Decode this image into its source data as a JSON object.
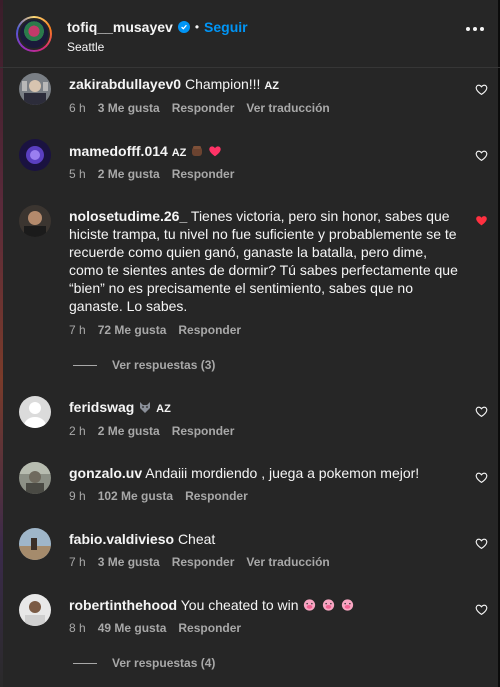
{
  "header": {
    "username": "tofiq__musayev",
    "separator": "•",
    "follow_label": "Seguir",
    "location": "Seattle"
  },
  "comments": [
    {
      "username": "zakirabdullayev0",
      "text": "Champion!!! ",
      "suffix": "AZ",
      "time": "6 h",
      "likes": "3 Me gusta",
      "reply": "Responder",
      "translate": "Ver traducción",
      "liked": false
    },
    {
      "username": "mamedofff.014",
      "text": "",
      "suffix": "AZ",
      "time": "5 h",
      "likes": "2 Me gusta",
      "reply": "Responder",
      "liked": false
    },
    {
      "username": "nolosetudime.26_",
      "text": "Tienes victoria, pero sin honor, sabes que hiciste trampa, tu nivel no fue suficiente y probablemente se te recuerde como quien ganó, ganaste la batalla, pero dime, como te sientes antes de dormir? Tú sabes perfectamente que “bien” no es precisamente el sentimiento, sabes que no ganaste. Lo sabes.",
      "time": "7 h",
      "likes": "72 Me gusta",
      "reply": "Responder",
      "view_replies": "Ver respuestas (3)",
      "liked": true
    },
    {
      "username": "feridswag",
      "suffix": "AZ",
      "time": "2 h",
      "likes": "2 Me gusta",
      "reply": "Responder",
      "liked": false
    },
    {
      "username": "gonzalo.uv",
      "text": "Andaiii mordiendo , juega a pokemon mejor!",
      "time": "9 h",
      "likes": "102 Me gusta",
      "reply": "Responder",
      "liked": false
    },
    {
      "username": "fabio.valdivieso",
      "text": "Cheat",
      "time": "7 h",
      "likes": "3 Me gusta",
      "reply": "Responder",
      "translate": "Ver traducción",
      "liked": false
    },
    {
      "username": "robertinthehood",
      "text": "You cheated to win",
      "time": "8 h",
      "likes": "49 Me gusta",
      "reply": "Responder",
      "view_replies": "Ver respuestas (4)",
      "liked": false
    }
  ],
  "colors": {
    "background": "#262626",
    "accent": "#0095f6",
    "liked_heart": "#ff3040",
    "meta_text": "#a8a8a8"
  }
}
